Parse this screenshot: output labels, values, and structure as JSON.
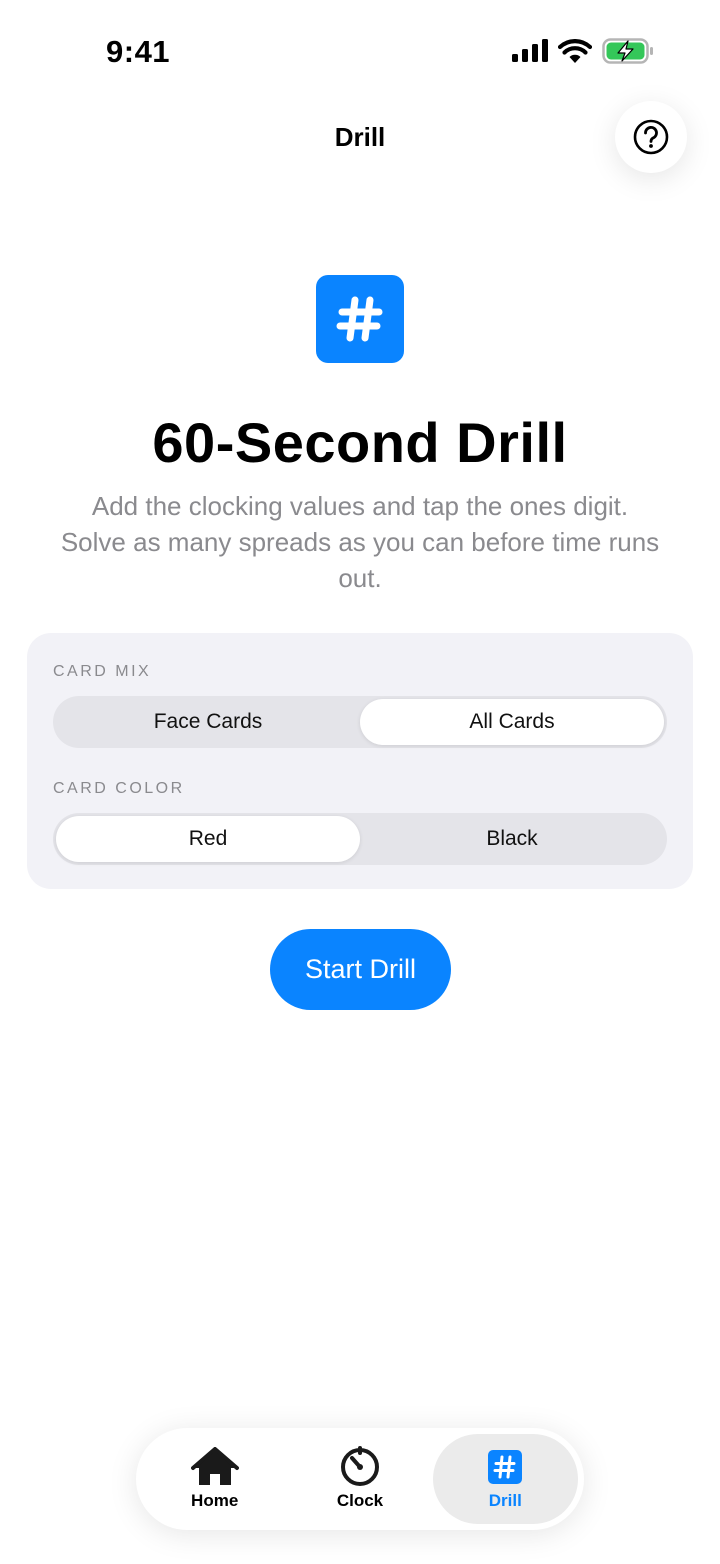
{
  "status_bar": {
    "time": "9:41"
  },
  "nav": {
    "title": "Drill"
  },
  "hero": {
    "icon_glyph": "#",
    "title": "60-Second Drill",
    "description": "Add the clocking values and tap the ones digit. Solve as many spreads as you can before time runs out."
  },
  "settings": {
    "card_mix": {
      "label": "CARD MIX",
      "options": [
        "Face Cards",
        "All Cards"
      ],
      "selected": "All Cards"
    },
    "card_color": {
      "label": "CARD COLOR",
      "options": [
        "Red",
        "Black"
      ],
      "selected": "Red"
    }
  },
  "start_button": {
    "label": "Start Drill"
  },
  "tabbar": {
    "items": [
      {
        "label": "Home",
        "icon": "house-icon"
      },
      {
        "label": "Clock",
        "icon": "timer-icon"
      },
      {
        "label": "Drill",
        "icon": "number-square-icon",
        "glyph": "#"
      }
    ],
    "selected": "Drill"
  },
  "colors": {
    "accent": "#0a84ff",
    "battery": "#34c759"
  }
}
